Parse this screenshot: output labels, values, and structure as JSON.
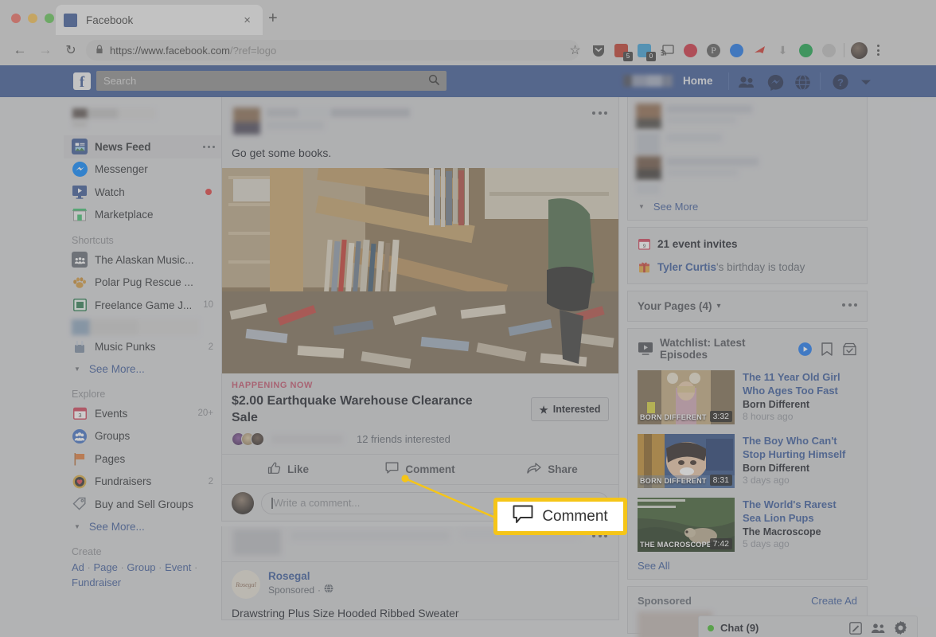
{
  "browser": {
    "tab_title": "Facebook",
    "tab_close": "×",
    "new_tab": "+",
    "back_icon": "←",
    "forward_icon": "→",
    "reload_icon": "↻",
    "lock_icon": "ὑ2",
    "url_secure": "https://www.facebook.com",
    "url_query": "/?ref=logo",
    "extensions": [
      {
        "name": "bookmark-star-icon",
        "glyph": "☆",
        "badge": ""
      },
      {
        "name": "pocket-shield-icon",
        "glyph": "✔",
        "badge": ""
      },
      {
        "name": "red-extension-icon",
        "glyph": "",
        "badge": "5"
      },
      {
        "name": "ghost-extension-icon",
        "glyph": "",
        "badge": "0"
      },
      {
        "name": "cast-icon",
        "glyph": "⧉",
        "badge": ""
      },
      {
        "name": "red-circle-extension-icon",
        "glyph": "",
        "badge": ""
      },
      {
        "name": "pinterest-icon",
        "glyph": "P",
        "badge": ""
      },
      {
        "name": "blue-circle-extension-icon",
        "glyph": "",
        "badge": ""
      },
      {
        "name": "red-arrow-extension-icon",
        "glyph": "➤",
        "badge": ""
      },
      {
        "name": "download-icon",
        "glyph": "⬇",
        "badge": ""
      },
      {
        "name": "green-circle-extension-icon",
        "glyph": "",
        "badge": ""
      },
      {
        "name": "grey-circle-extension-icon",
        "glyph": "",
        "badge": ""
      }
    ]
  },
  "fbnav": {
    "logo": "f",
    "search_placeholder": "Search",
    "search_icon": "search-icon",
    "home_label": "Home",
    "icons": [
      "friend-requests-icon",
      "messenger-icon",
      "notifications-globe-icon",
      "help-icon",
      "account-dropdown-icon"
    ]
  },
  "sidebar": {
    "main_items": [
      {
        "label": "News Feed",
        "icon": "news-feed-icon",
        "count": "",
        "active": true,
        "dots": true
      },
      {
        "label": "Messenger",
        "icon": "messenger-icon",
        "count": "",
        "active": false,
        "dot": false
      },
      {
        "label": "Watch",
        "icon": "watch-icon",
        "count": "",
        "active": false,
        "dot": true
      },
      {
        "label": "Marketplace",
        "icon": "marketplace-icon",
        "count": "",
        "active": false,
        "dot": false
      }
    ],
    "shortcuts_header": "Shortcuts",
    "shortcuts": [
      {
        "label": "The Alaskan Music...",
        "icon": "group-icon",
        "count": ""
      },
      {
        "label": "Polar Pug Rescue ...",
        "icon": "paw-icon",
        "count": ""
      },
      {
        "label": "Freelance Game J...",
        "icon": "page-icon",
        "count": "10"
      },
      {
        "label": "Music Punks",
        "icon": "hand-icon",
        "count": "2"
      }
    ],
    "see_more_1": "See More...",
    "explore_header": "Explore",
    "explore": [
      {
        "label": "Events",
        "icon": "calendar-icon",
        "count": "20+"
      },
      {
        "label": "Groups",
        "icon": "groups-icon",
        "count": ""
      },
      {
        "label": "Pages",
        "icon": "flag-icon",
        "count": ""
      },
      {
        "label": "Fundraisers",
        "icon": "heart-coin-icon",
        "count": "2"
      },
      {
        "label": "Buy and Sell Groups",
        "icon": "tag-icon",
        "count": ""
      }
    ],
    "see_more_2": "See More...",
    "create_header": "Create",
    "create_links": [
      "Ad",
      "Page",
      "Group",
      "Event",
      "Fundraiser"
    ]
  },
  "feed": {
    "post1": {
      "text": "Go get some books.",
      "menu_icon": "post-menu-icon",
      "event": {
        "kicker": "HAPPENING NOW",
        "title": "$2.00 Earthquake Warehouse Clearance Sale",
        "interested_button": "Interested",
        "interested_star": "★",
        "friends_interested": "12 friends interested"
      },
      "actions": [
        {
          "label": "Like",
          "icon": "thumbs-up-icon"
        },
        {
          "label": "Comment",
          "icon": "comment-bubble-icon"
        },
        {
          "label": "Share",
          "icon": "share-arrow-icon"
        }
      ],
      "comment_placeholder": "Write a comment..."
    },
    "post2": {
      "menu_icon": "post-menu-icon",
      "page_name": "Rosegal",
      "page_avatar_text": "Rosegal",
      "sponsored_label": "Sponsored",
      "audience_icon": "globe-icon",
      "ad_title": "Drawstring Plus Size Hooded Ribbed Sweater"
    }
  },
  "right_sidebar": {
    "see_more": "See More",
    "events_card": {
      "invites": "21 event invites",
      "invites_icon": "calendar-icon",
      "birthday_name": "Tyler Curtis",
      "birthday_rest": "'s birthday is today",
      "birthday_icon": "gift-icon"
    },
    "your_pages": {
      "title": "Your Pages (4)",
      "caret": "▾",
      "menu_icon": "pages-menu-icon"
    },
    "watchlist": {
      "title": "Watchlist: Latest Episodes",
      "header_icon": "tv-icon",
      "action_icons": [
        "watch-now-icon",
        "saved-videos-icon",
        "watched-icon"
      ],
      "videos": [
        {
          "title": "The 11 Year Old Girl Who Ages Too Fast",
          "show": "Born Different",
          "time": "8 hours ago",
          "duration": "3:32",
          "overlay": "BORN DIFFERENT"
        },
        {
          "title": "The Boy Who Can't Stop Hurting Himself",
          "show": "Born Different",
          "time": "3 days ago",
          "duration": "8:31",
          "overlay": "BORN DIFFERENT"
        },
        {
          "title": "The World's Rarest Sea Lion Pups",
          "show": "The Macroscope",
          "time": "5 days ago",
          "duration": "7:42",
          "overlay": "THE MACROSCOPE"
        }
      ],
      "see_all": "See All"
    },
    "sponsored": {
      "title": "Sponsored",
      "create_ad": "Create Ad"
    }
  },
  "chat": {
    "label": "Chat (9)",
    "status_color": "#42b72a",
    "icons": [
      "compose-message-icon",
      "friend-list-icon",
      "chat-settings-icon"
    ]
  },
  "callout": {
    "label": "Comment",
    "icon": "comment-bubble-icon",
    "border_color": "#f5c518"
  }
}
